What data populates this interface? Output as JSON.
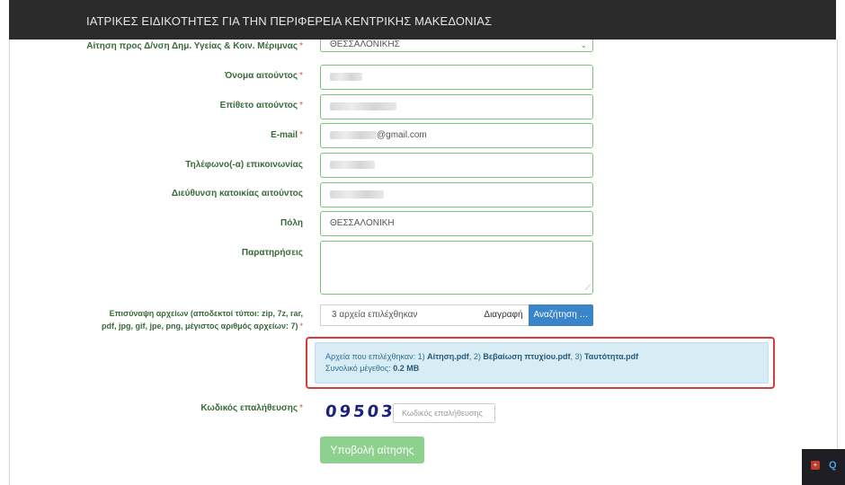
{
  "header": {
    "title": "ΙΑΤΡΙΚΕΣ ΕΙΔΙΚΟΤΗΤΕΣ ΓΙΑ ΤΗΝ ΠΕΡΙΦΕΡΕΙΑ ΚΕΝΤΡΙΚΗΣ ΜΑΚΕΔΟΝΙΑΣ"
  },
  "form": {
    "required_mark": "*",
    "department": {
      "label": "Αίτηση προς Δ/νση Δημ. Υγείας & Κοιν. Μέριμνας",
      "value": "ΘΕΣΣΑΛΟΝΙΚΗΣ"
    },
    "first_name": {
      "label": "Όνομα αιτούντος"
    },
    "last_name": {
      "label": "Επίθετο αιτούντος"
    },
    "email": {
      "label": "E-mail",
      "visible_suffix": "@gmail.com"
    },
    "phone": {
      "label": "Τηλέφωνο(-α) επικοινωνίας"
    },
    "address": {
      "label": "Διεύθυνση κατοικίας αιτούντος"
    },
    "city": {
      "label": "Πόλη",
      "value": "ΘΕΣΣΑΛΟΝΙΚΗ"
    },
    "notes": {
      "label": "Παρατηρήσεις",
      "value": ""
    },
    "attachments": {
      "label_line1": "Επισύναψη αρχείων (αποδεκτοί τύποι: zip, 7z, rar,",
      "label_line2": "pdf, jpg, gif, jpe, png, μέγιστος αριθμός αρχείων: 7)",
      "selected_text": "3 αρχεία επιλέχθηκαν",
      "delete_label": "Διαγραφή",
      "browse_label": "Αναζήτηση …",
      "info_prefix": "Αρχεία που επιλέχθηκαν: 1) ",
      "files": [
        "Αίτηση.pdf",
        "Βεβαίωση πτυχίου.pdf",
        "Ταυτότητα.pdf"
      ],
      "sep2": ", 2) ",
      "sep3": ", 3) ",
      "total_label": "Συνολικό μέγεθος: ",
      "total_size": "0.2 MB"
    },
    "captcha": {
      "label": "Κωδικός επαλήθευσης",
      "code": "09503",
      "placeholder": "Κωδικός επαλήθευσης"
    },
    "submit_label": "Υποβολή αίτησης"
  }
}
